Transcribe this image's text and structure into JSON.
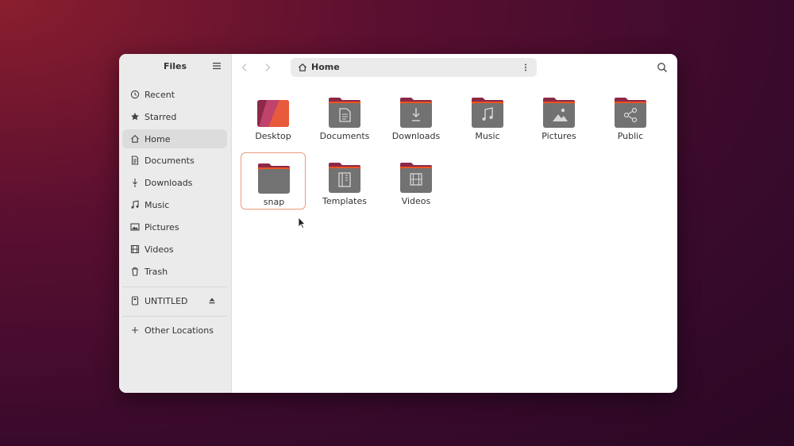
{
  "sidebar": {
    "title": "Files",
    "places": [
      {
        "label": "Recent",
        "icon": "clock-icon"
      },
      {
        "label": "Starred",
        "icon": "star-icon"
      },
      {
        "label": "Home",
        "icon": "home-icon",
        "active": true
      },
      {
        "label": "Documents",
        "icon": "document-icon"
      },
      {
        "label": "Downloads",
        "icon": "download-icon"
      },
      {
        "label": "Music",
        "icon": "music-icon"
      },
      {
        "label": "Pictures",
        "icon": "picture-icon"
      },
      {
        "label": "Videos",
        "icon": "video-icon"
      },
      {
        "label": "Trash",
        "icon": "trash-icon"
      }
    ],
    "devices": [
      {
        "label": "UNTITLED",
        "icon": "drive-icon",
        "ejectable": true
      }
    ],
    "other": {
      "label": "Other Locations",
      "icon": "plus-icon"
    }
  },
  "toolbar": {
    "location": "Home"
  },
  "files": [
    {
      "name": "Desktop",
      "type": "desktop"
    },
    {
      "name": "Documents",
      "type": "documents"
    },
    {
      "name": "Downloads",
      "type": "downloads"
    },
    {
      "name": "Music",
      "type": "music"
    },
    {
      "name": "Pictures",
      "type": "pictures"
    },
    {
      "name": "Public",
      "type": "public"
    },
    {
      "name": "snap",
      "type": "plain",
      "selected": true
    },
    {
      "name": "Templates",
      "type": "templates"
    },
    {
      "name": "Videos",
      "type": "videos"
    }
  ],
  "colors": {
    "accent": "#e95420",
    "folder_body": "#727272",
    "folder_tab": "#8c2848"
  }
}
